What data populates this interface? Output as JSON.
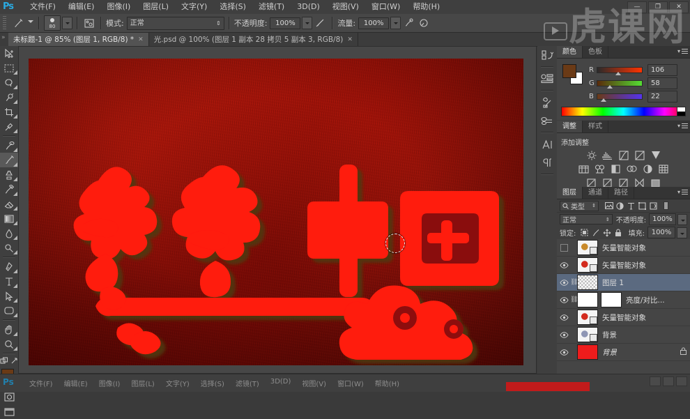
{
  "app": {
    "name": "Adobe Photoshop",
    "logo": "Ps"
  },
  "titlebar": {
    "menu": [
      {
        "label": "文件(F)",
        "name": "menu-file"
      },
      {
        "label": "编辑(E)",
        "name": "menu-edit"
      },
      {
        "label": "图像(I)",
        "name": "menu-image"
      },
      {
        "label": "图层(L)",
        "name": "menu-layer"
      },
      {
        "label": "文字(Y)",
        "name": "menu-type"
      },
      {
        "label": "选择(S)",
        "name": "menu-select"
      },
      {
        "label": "滤镜(T)",
        "name": "menu-filter"
      },
      {
        "label": "3D(D)",
        "name": "menu-3d"
      },
      {
        "label": "视图(V)",
        "name": "menu-view"
      },
      {
        "label": "窗口(W)",
        "name": "menu-window"
      },
      {
        "label": "帮助(H)",
        "name": "menu-help"
      }
    ],
    "window_controls": {
      "minimize": "—",
      "maximize": "❐",
      "close": "✕"
    }
  },
  "options_bar": {
    "brush_size": "80",
    "mode_label": "模式:",
    "mode_value": "正常",
    "opacity_label": "不透明度:",
    "opacity_value": "100%",
    "flow_label": "流量:",
    "flow_value": "100%"
  },
  "doc_tabs": [
    {
      "label": "未标题-1 @ 85% (图层 1, RGB/8) *",
      "active": true,
      "close": "✕"
    },
    {
      "label": "光.psd @ 100% (图层 1 副本 28 拷贝 5 副本 3, RGB/8)",
      "active": false,
      "close": "✕"
    }
  ],
  "tools": [
    {
      "name": "move-tool",
      "glyph": "move"
    },
    {
      "name": "marquee-tool",
      "glyph": "marquee"
    },
    {
      "name": "lasso-tool",
      "glyph": "lasso"
    },
    {
      "name": "quick-select-tool",
      "glyph": "wand"
    },
    {
      "name": "crop-tool",
      "glyph": "crop"
    },
    {
      "name": "eyedropper-tool",
      "glyph": "eyedropper"
    },
    {
      "name": "healing-brush-tool",
      "glyph": "heal"
    },
    {
      "name": "brush-tool",
      "glyph": "brush",
      "active": true
    },
    {
      "name": "clone-stamp-tool",
      "glyph": "stamp"
    },
    {
      "name": "history-brush-tool",
      "glyph": "historybrush"
    },
    {
      "name": "eraser-tool",
      "glyph": "eraser"
    },
    {
      "name": "gradient-tool",
      "glyph": "gradient"
    },
    {
      "name": "blur-tool",
      "glyph": "blur"
    },
    {
      "name": "dodge-tool",
      "glyph": "dodge"
    },
    {
      "name": "pen-tool",
      "glyph": "pen"
    },
    {
      "name": "type-tool",
      "glyph": "type"
    },
    {
      "name": "path-select-tool",
      "glyph": "pathselect"
    },
    {
      "name": "shape-tool",
      "glyph": "shape"
    },
    {
      "name": "hand-tool",
      "glyph": "hand"
    },
    {
      "name": "zoom-tool",
      "glyph": "zoom"
    }
  ],
  "colors": {
    "foreground": "#6A3A16",
    "background": "#FFFFFF",
    "canvas_bg": "#8C1208",
    "art_red": "#FF1A0D",
    "selection_blue": "#5B6A80"
  },
  "icon_strip": [
    {
      "name": "history-panel-icon"
    },
    {
      "name": "properties-panel-icon"
    },
    {
      "name": "brush-panel-icon"
    },
    {
      "name": "brush-presets-panel-icon"
    },
    {
      "name": "character-panel-icon"
    },
    {
      "name": "paragraph-panel-icon"
    }
  ],
  "color_panel": {
    "tabs": [
      {
        "label": "颜色",
        "active": true
      },
      {
        "label": "色板",
        "active": false
      }
    ],
    "channels": [
      {
        "label": "R",
        "value": "106",
        "pos": 41
      },
      {
        "label": "G",
        "value": "58",
        "pos": 22
      },
      {
        "label": "B",
        "value": "22",
        "pos": 8
      }
    ]
  },
  "adjustments_panel": {
    "tabs": [
      {
        "label": "调整",
        "active": true
      },
      {
        "label": "样式",
        "active": false
      }
    ],
    "title": "添加调整",
    "row1": [
      "brightness-contrast-icon",
      "levels-icon",
      "curves-icon",
      "exposure-icon",
      "vibrance-icon"
    ],
    "row2": [
      "hue-saturation-icon",
      "color-balance-icon",
      "black-white-icon",
      "photo-filter-icon",
      "channel-mixer-icon",
      "color-lookup-icon"
    ],
    "row3": [
      "invert-icon",
      "posterize-icon",
      "threshold-icon",
      "gradient-map-icon",
      "selective-color-icon"
    ]
  },
  "layers_panel": {
    "tabs": [
      {
        "label": "图层",
        "active": true
      },
      {
        "label": "通道",
        "active": false
      },
      {
        "label": "路径",
        "active": false
      }
    ],
    "filter_label": "类型",
    "filter_icons": [
      "filter-image-icon",
      "filter-adjustment-icon",
      "filter-text-icon",
      "filter-shape-icon",
      "filter-smartobject-icon",
      "filter-toggle-icon"
    ],
    "blend_mode": "正常",
    "opacity_label": "不透明度:",
    "opacity_value": "100%",
    "lock_label": "锁定:",
    "lock_icons": [
      "lock-transparency-icon",
      "lock-image-icon",
      "lock-position-icon",
      "lock-all-icon"
    ],
    "fill_label": "填充:",
    "fill_value": "100%",
    "layers": [
      {
        "name": "矢量智能对象",
        "visible": false,
        "kind": "smart-object",
        "thumb": "#c98a2a",
        "selected": false
      },
      {
        "name": "矢量智能对象",
        "visible": true,
        "kind": "smart-object",
        "thumb": "#d32b1e",
        "selected": false
      },
      {
        "name": "图层 1",
        "visible": true,
        "kind": "pixel",
        "thumb": "checker",
        "selected": true,
        "linked": true
      },
      {
        "name": "亮度/对比...",
        "visible": true,
        "kind": "adjustment",
        "thumb": "#ffffff",
        "selected": false,
        "linked": true
      },
      {
        "name": "矢量智能对象",
        "visible": true,
        "kind": "smart-object",
        "thumb": "#d32b1e",
        "selected": false
      },
      {
        "name": "背景",
        "visible": true,
        "kind": "smart-object",
        "thumb": "#8e96b4",
        "selected": false
      },
      {
        "name": "背景",
        "visible": true,
        "kind": "locked",
        "thumb": "#ee1c1c",
        "selected": false,
        "locked": true
      }
    ]
  },
  "watermark": {
    "text": "虎课网",
    "play_icon": "play-icon"
  },
  "background_window": {
    "logo": "Ps",
    "menu": [
      "文件(F)",
      "编辑(E)",
      "图像(I)",
      "图层(L)",
      "文字(Y)",
      "选择(S)",
      "滤镜(T)",
      "3D(D)",
      "视图(V)",
      "窗口(W)",
      "帮助(H)"
    ]
  }
}
